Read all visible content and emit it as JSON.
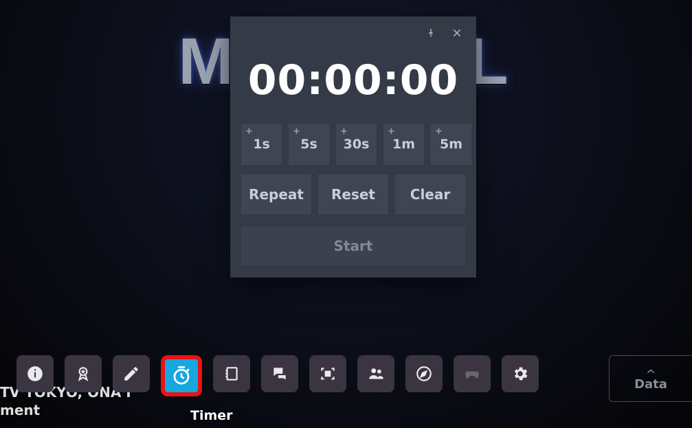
{
  "background": {
    "title": "MAS        UEL",
    "credit_line1": " TV TOKYO,   ONA  I",
    "credit_line2": "ment"
  },
  "timer_panel": {
    "time": "00:00:00",
    "presets": [
      "1s",
      "5s",
      "30s",
      "1m",
      "5m"
    ],
    "plus": "+",
    "buttons": {
      "repeat": "Repeat",
      "reset": "Reset",
      "clear": "Clear"
    },
    "start": "Start"
  },
  "toolbar": {
    "items": [
      {
        "name": "info",
        "label": ""
      },
      {
        "name": "badges",
        "label": ""
      },
      {
        "name": "edit",
        "label": ""
      },
      {
        "name": "timer",
        "label": "Timer",
        "active": true
      },
      {
        "name": "notes",
        "label": ""
      },
      {
        "name": "chat",
        "label": ""
      },
      {
        "name": "capture",
        "label": ""
      },
      {
        "name": "friends",
        "label": ""
      },
      {
        "name": "explore",
        "label": ""
      },
      {
        "name": "controller",
        "label": "",
        "disabled": true
      },
      {
        "name": "settings",
        "label": ""
      }
    ],
    "active_label": "Timer"
  },
  "edge": {
    "label": "Data"
  }
}
